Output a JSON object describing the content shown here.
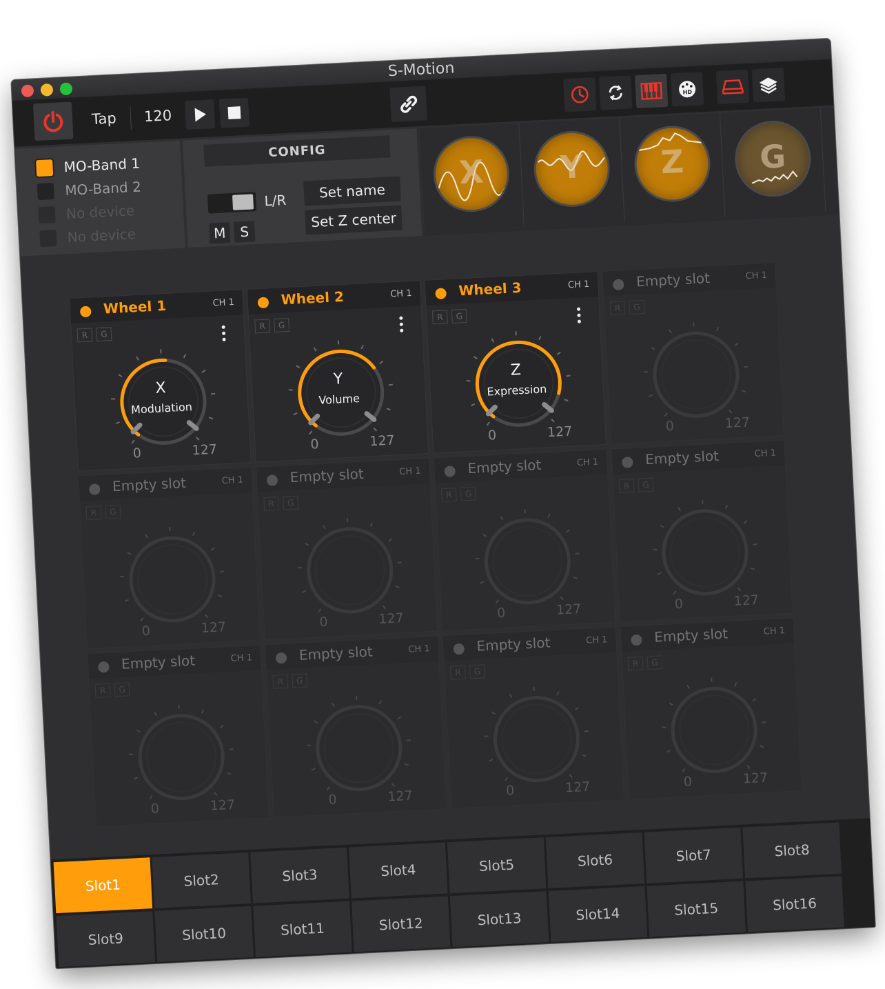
{
  "window": {
    "title": "S-Motion"
  },
  "toolbar": {
    "tap_label": "Tap",
    "bpm": "120"
  },
  "devices": [
    {
      "name": "MO-Band 1",
      "state": "active"
    },
    {
      "name": "MO-Band 2",
      "state": "available"
    },
    {
      "name": "No device",
      "state": "none"
    },
    {
      "name": "No device",
      "state": "none"
    }
  ],
  "config": {
    "title": "CONFIG",
    "toggle_label": "L/R",
    "m_label": "M",
    "s_label": "S",
    "set_name_label": "Set name",
    "set_z_center_label": "Set Z center"
  },
  "orbs": [
    {
      "letter": "X"
    },
    {
      "letter": "Y"
    },
    {
      "letter": "Z"
    },
    {
      "letter": "G"
    }
  ],
  "slots": [
    {
      "name": "Wheel 1",
      "ch": "CH 1",
      "axis": "X",
      "param": "Modulation",
      "min": "0",
      "max": "127",
      "active": true
    },
    {
      "name": "Wheel 2",
      "ch": "CH 1",
      "axis": "Y",
      "param": "Volume",
      "min": "0",
      "max": "127",
      "active": true
    },
    {
      "name": "Wheel 3",
      "ch": "CH 1",
      "axis": "Z",
      "param": "Expression",
      "min": "0",
      "max": "127",
      "active": true
    },
    {
      "name": "Empty slot",
      "ch": "CH 1",
      "axis": "",
      "param": "",
      "min": "0",
      "max": "127",
      "active": false
    },
    {
      "name": "Empty slot",
      "ch": "CH 1",
      "axis": "",
      "param": "",
      "min": "0",
      "max": "127",
      "active": false
    },
    {
      "name": "Empty slot",
      "ch": "CH 1",
      "axis": "",
      "param": "",
      "min": "0",
      "max": "127",
      "active": false
    },
    {
      "name": "Empty slot",
      "ch": "CH 1",
      "axis": "",
      "param": "",
      "min": "0",
      "max": "127",
      "active": false
    },
    {
      "name": "Empty slot",
      "ch": "CH 1",
      "axis": "",
      "param": "",
      "min": "0",
      "max": "127",
      "active": false
    },
    {
      "name": "Empty slot",
      "ch": "CH 1",
      "axis": "",
      "param": "",
      "min": "0",
      "max": "127",
      "active": false
    },
    {
      "name": "Empty slot",
      "ch": "CH 1",
      "axis": "",
      "param": "",
      "min": "0",
      "max": "127",
      "active": false
    },
    {
      "name": "Empty slot",
      "ch": "CH 1",
      "axis": "",
      "param": "",
      "min": "0",
      "max": "127",
      "active": false
    },
    {
      "name": "Empty slot",
      "ch": "CH 1",
      "axis": "",
      "param": "",
      "min": "0",
      "max": "127",
      "active": false
    }
  ],
  "slot_rg": {
    "r": "R",
    "g": "G"
  },
  "slot_tabs": [
    "Slot1",
    "Slot2",
    "Slot3",
    "Slot4",
    "Slot5",
    "Slot6",
    "Slot7",
    "Slot8",
    "Slot9",
    "Slot10",
    "Slot11",
    "Slot12",
    "Slot13",
    "Slot14",
    "Slot15",
    "Slot16"
  ],
  "active_tab": 0,
  "colors": {
    "accent": "#ff9d0a",
    "power": "#e8362a",
    "bg": "#2f2f31"
  },
  "icons": {
    "power": "power-icon",
    "play": "play-icon",
    "stop": "stop-icon",
    "link": "link-icon",
    "clock": "clock-icon",
    "sync": "sync-icon",
    "piano": "piano-icon",
    "midi_hd": "midi-hd-icon",
    "device": "device-icon",
    "layers": "layers-icon"
  }
}
